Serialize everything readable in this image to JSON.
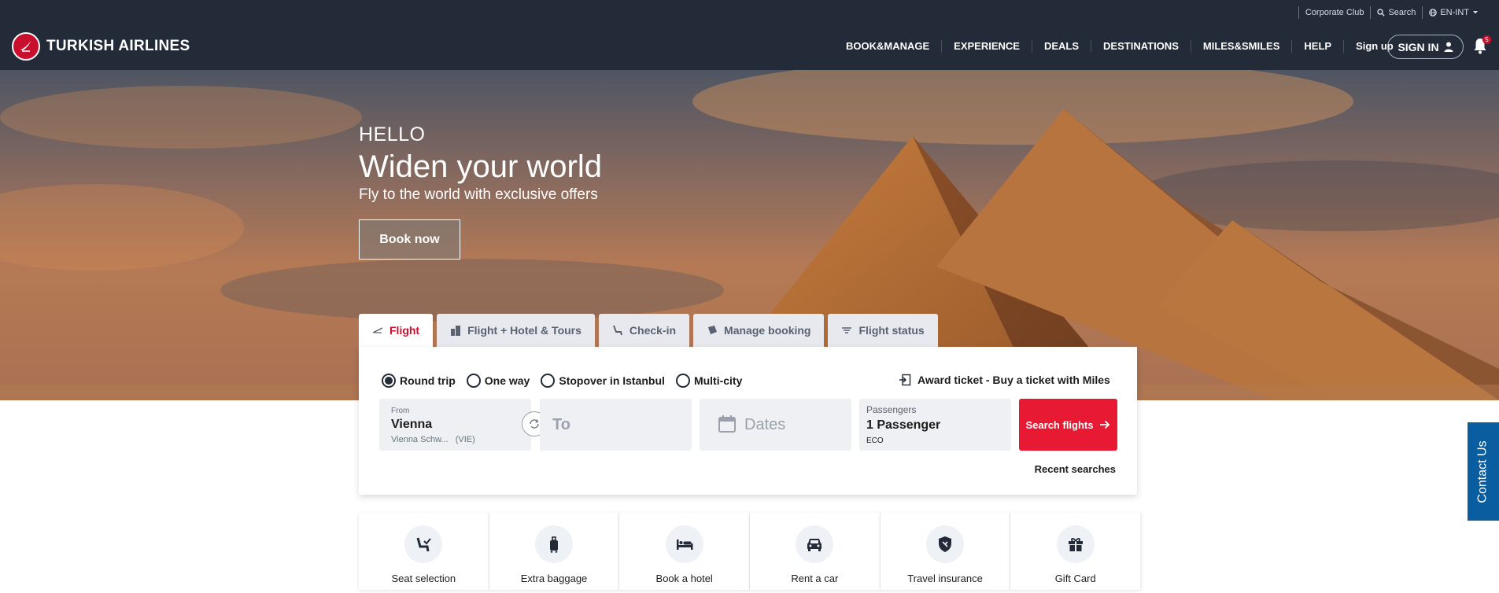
{
  "topbar": {
    "corporate": "Corporate Club",
    "search": "Search",
    "language": "EN-INT"
  },
  "brand": {
    "name": "TURKISH AIRLINES"
  },
  "nav": {
    "items": [
      "BOOK&MANAGE",
      "EXPERIENCE",
      "DEALS",
      "DESTINATIONS",
      "MILES&SMILES",
      "HELP",
      "Sign up"
    ],
    "signin": "SIGN IN",
    "notifications": "5"
  },
  "hero": {
    "hello": "HELLO",
    "headline": "Widen your world",
    "subline": "Fly to the world with exclusive offers",
    "cta": "Book now"
  },
  "tabs": [
    {
      "label": "Flight",
      "icon": "plane-icon",
      "active": true
    },
    {
      "label": "Flight + Hotel & Tours",
      "icon": "hotel-icon",
      "active": false
    },
    {
      "label": "Check-in",
      "icon": "seat-icon",
      "active": false
    },
    {
      "label": "Manage booking",
      "icon": "ticket-icon",
      "active": false
    },
    {
      "label": "Flight status",
      "icon": "plane-status-icon",
      "active": false
    }
  ],
  "booking": {
    "trip_types": [
      {
        "label": "Round trip",
        "selected": true
      },
      {
        "label": "One way",
        "selected": false
      },
      {
        "label": "Stopover in Istanbul",
        "selected": false
      },
      {
        "label": "Multi-city",
        "selected": false
      }
    ],
    "award": "Award ticket - Buy a ticket with Miles",
    "from_label": "From",
    "from_city": "Vienna",
    "from_airport": "Vienna Schw...",
    "from_code": "(VIE)",
    "to_placeholder": "To",
    "dates_placeholder": "Dates",
    "passengers_label": "Passengers",
    "passengers_value": "1 Passenger",
    "cabin": "ECO",
    "search_button": "Search flights",
    "recent": "Recent searches"
  },
  "services": [
    {
      "label": "Seat selection",
      "icon": "seat-selection-icon"
    },
    {
      "label": "Extra baggage",
      "icon": "baggage-icon"
    },
    {
      "label": "Book a hotel",
      "icon": "bed-icon"
    },
    {
      "label": "Rent a car",
      "icon": "car-icon"
    },
    {
      "label": "Travel insurance",
      "icon": "shield-icon"
    },
    {
      "label": "Gift Card",
      "icon": "gift-icon"
    }
  ],
  "contact": "Contact Us",
  "colors": {
    "navbar": "#232b38",
    "accent_red": "#c8102e",
    "search_red": "#e81932",
    "contact_blue": "#0a5d9e"
  }
}
